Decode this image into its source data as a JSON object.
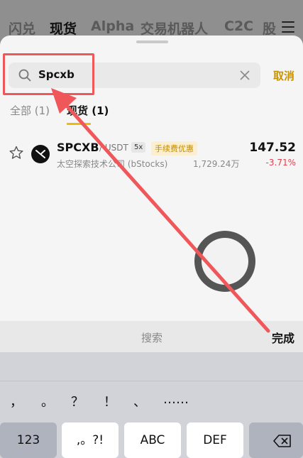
{
  "background_nav": {
    "tabs": [
      "闪兑",
      "现货",
      "Alpha",
      "交易机器人",
      "C2C",
      "股"
    ],
    "active_index": 1
  },
  "search": {
    "query": "Spcxb",
    "cancel_label": "取消"
  },
  "filter_tabs": {
    "all": "全部 (1)",
    "spot": "现货 (1)",
    "active": "spot"
  },
  "result": {
    "symbol": "SPCXB",
    "quote": "/ USDT",
    "leverage": "5x",
    "fee_badge": "手续费优惠",
    "name": "太空探索技术公司 (bStocks)",
    "volume": "1,729.24万",
    "price": "147.52",
    "change": "-3.71%"
  },
  "keyboard": {
    "search_label": "搜索",
    "done_label": "完成",
    "punctuation": [
      "，",
      "。",
      "？",
      "！",
      "、",
      "……"
    ],
    "keys": [
      "123",
      ",。?!",
      "ABC",
      "DEF"
    ]
  },
  "colors": {
    "accent": "#f0b90b",
    "negative": "#e63e4d",
    "annotation": "#f0575b"
  }
}
